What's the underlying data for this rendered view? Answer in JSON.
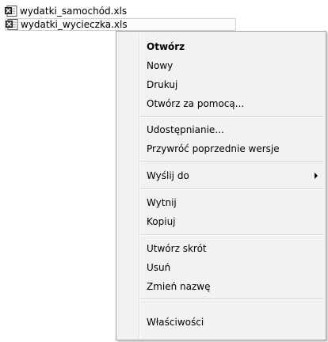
{
  "files": [
    {
      "name": "wydatki_samochód.xls",
      "icon": "excel-file-icon"
    },
    {
      "name": "wydatki_wycieczka.xls",
      "icon": "excel-file-icon"
    }
  ],
  "context_menu": {
    "items": [
      {
        "label": "Otwórz",
        "bold": true
      },
      {
        "label": "Nowy"
      },
      {
        "label": "Drukuj"
      },
      {
        "label": "Otwórz za pomocą..."
      },
      {
        "label": "Udostępnianie..."
      },
      {
        "label": "Przywróć poprzednie wersje"
      },
      {
        "label": "Wyślij do",
        "submenu": true
      },
      {
        "label": "Wytnij"
      },
      {
        "label": "Kopiuj"
      },
      {
        "label": "Utwórz skrót"
      },
      {
        "label": "Usuń"
      },
      {
        "label": "Zmień nazwę"
      },
      {
        "label": "Właściwości"
      }
    ]
  },
  "colors": {
    "menu_background": "#f2f2f2",
    "menu_border": "#a6a6a6",
    "selected_file_border": "#cfcfcf"
  }
}
